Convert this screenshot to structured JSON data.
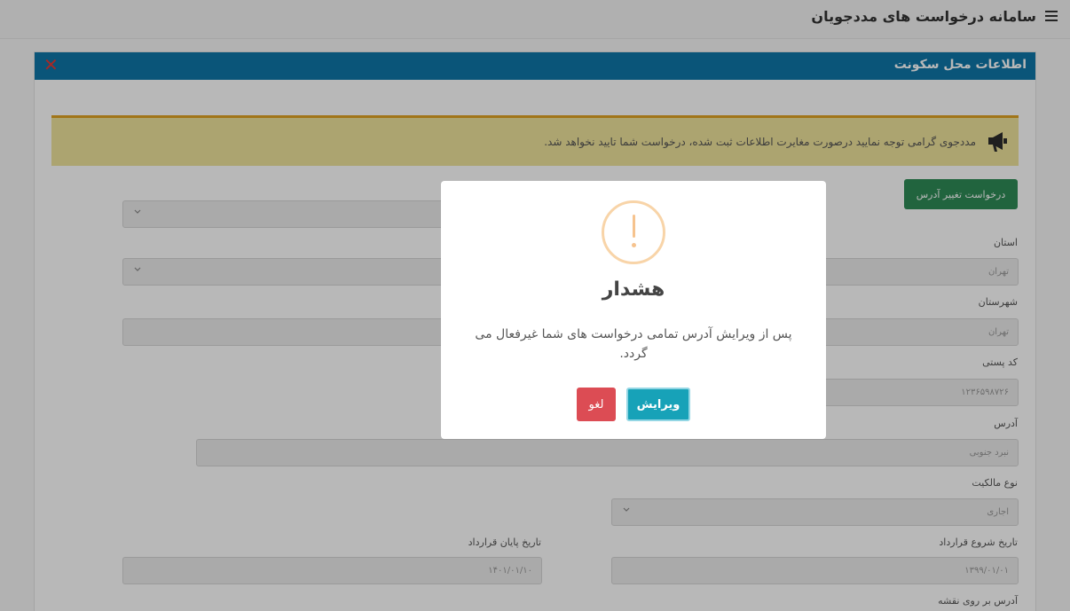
{
  "app": {
    "title": "سامانه درخواست های مددجویان"
  },
  "panel": {
    "title": "اطلاعات محل سکونت",
    "close_symbol": "✕"
  },
  "alert": {
    "icon": "megaphone-icon",
    "text": "مددجوی گرامی توجه نمایید درصورت مغایرت اطلاعات ثبت شده، درخواست شما تایید نخواهد شد."
  },
  "form": {
    "change_address_button": "درخواست تغییر آدرس",
    "province": {
      "label": "استان",
      "value": "تهران"
    },
    "city": {
      "label": "شهرستان",
      "value": "تهران"
    },
    "postal_code": {
      "label": "کد پستی",
      "value": "۱۲۳۶۵۹۸۷۲۶"
    },
    "address": {
      "label": "آدرس",
      "value": "نبرد جنوبی"
    },
    "ownership": {
      "label": "نوع مالکیت",
      "value": "اجاری"
    },
    "contract_start": {
      "label": "تاریخ شروع قرارداد",
      "value": "۱۳۹۹/۰۱/۰۱"
    },
    "contract_end": {
      "label": "تاریخ پایان قرارداد",
      "value": "۱۴۰۱/۰۱/۱۰"
    },
    "map_address": {
      "label": "آدرس بر روی نقشه"
    }
  },
  "modal": {
    "icon": "warning-icon",
    "title": "هشدار",
    "message": "پس از ویرایش آدرس تمامی درخواست های شما غیرفعال می گردد.",
    "confirm_label": "ویرایش",
    "cancel_label": "لغو"
  },
  "colors": {
    "header": "#0e76a8",
    "alert_bg": "#efe39b",
    "success": "#2e8b57",
    "confirm": "#17a2b8",
    "cancel": "#dc4c54"
  }
}
